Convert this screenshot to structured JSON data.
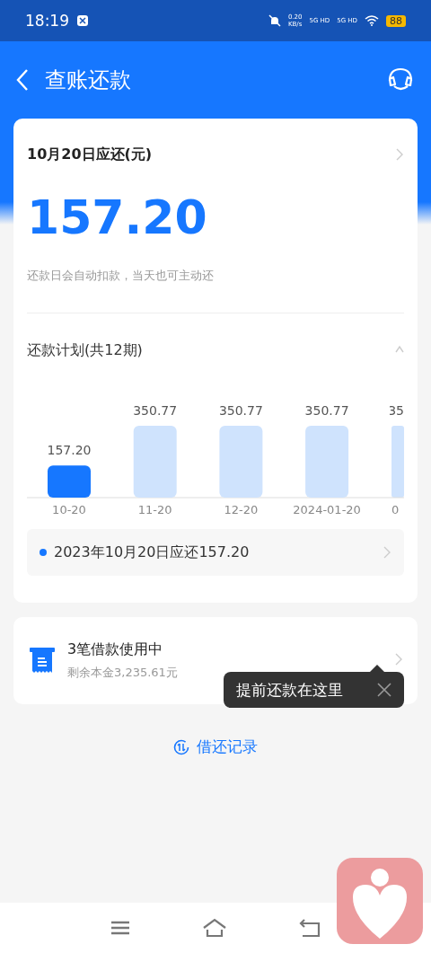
{
  "status_bar": {
    "time": "18:19",
    "net_speed": "0.20",
    "net_unit": "KB/s",
    "sim1": "5G HD",
    "sim2": "5G HD",
    "battery": "88"
  },
  "header": {
    "title": "查账还款"
  },
  "due_card": {
    "title": "10月20日应还(元)",
    "amount": "157.20",
    "note": "还款日会自动扣款，当天也可主动还",
    "plan": {
      "title": "还款计划(共12期)",
      "expanded": true,
      "chart_data": {
        "type": "bar",
        "categories": [
          "10-20",
          "11-20",
          "12-20",
          "2024-01-20"
        ],
        "values": [
          157.2,
          350.77,
          350.77,
          350.77
        ],
        "value_labels": [
          "157.20",
          "350.77",
          "350.77",
          "350.77"
        ]
      },
      "bar_states": [
        {
          "selected": true
        },
        {
          "selected": false
        },
        {
          "selected": false
        },
        {
          "selected": false
        }
      ],
      "cut_bar": {
        "value_label": "35",
        "category": "0"
      }
    },
    "selected_item": "2023年10月20日应还157.20"
  },
  "loans_card": {
    "title": "3笔借款使用中",
    "subtitle": "剩余本金3,235.61元"
  },
  "tooltip": {
    "text": "提前还款在这里"
  },
  "records_link": "借还记录"
}
